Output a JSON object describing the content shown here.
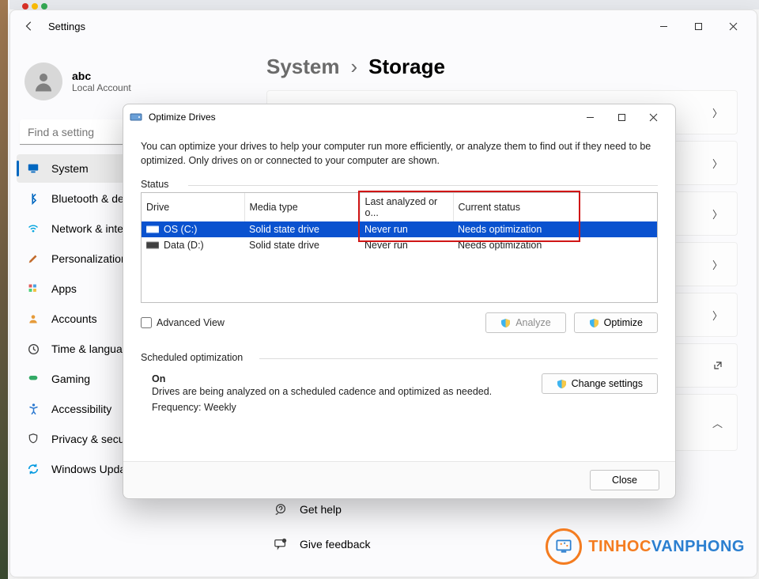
{
  "window": {
    "appTitle": "Settings"
  },
  "user": {
    "name": "abc",
    "sub": "Local Account"
  },
  "search": {
    "placeholder": "Find a setting"
  },
  "nav": [
    {
      "label": "System",
      "active": true,
      "iconColor": "#0067c0",
      "iconName": "display-icon"
    },
    {
      "label": "Bluetooth & devices",
      "iconColor": "#0067c0",
      "iconName": "bluetooth-icon"
    },
    {
      "label": "Network & internet",
      "iconColor": "#00a4df",
      "iconName": "wifi-icon"
    },
    {
      "label": "Personalization",
      "iconColor": "#c26b2c",
      "iconName": "brush-icon"
    },
    {
      "label": "Apps",
      "iconColor": "#404040",
      "iconName": "apps-icon"
    },
    {
      "label": "Accounts",
      "iconColor": "#e69b3a",
      "iconName": "person-icon"
    },
    {
      "label": "Time & language",
      "iconColor": "#404040",
      "iconName": "clock-icon"
    },
    {
      "label": "Gaming",
      "iconColor": "#33aa66",
      "iconName": "gaming-icon"
    },
    {
      "label": "Accessibility",
      "iconColor": "#2a78d0",
      "iconName": "accessibility-icon"
    },
    {
      "label": "Privacy & security",
      "iconColor": "#404040",
      "iconName": "shield-icon"
    },
    {
      "label": "Windows Update",
      "iconColor": "#0099e0",
      "iconName": "update-icon"
    }
  ],
  "breadcrumb": {
    "parent": "System",
    "current": "Storage"
  },
  "help": {
    "get": "Get help",
    "feedback": "Give feedback"
  },
  "dialog": {
    "title": "Optimize Drives",
    "desc": "You can optimize your drives to help your computer run more efficiently, or analyze them to find out if they need to be optimized. Only drives on or connected to your computer are shown.",
    "statusLabel": "Status",
    "columns": {
      "drive": "Drive",
      "media": "Media type",
      "last": "Last analyzed or o...",
      "status": "Current status"
    },
    "drives": [
      {
        "name": "OS (C:)",
        "media": "Solid state drive",
        "last": "Never run",
        "status": "Needs optimization",
        "selected": true
      },
      {
        "name": "Data (D:)",
        "media": "Solid state drive",
        "last": "Never run",
        "status": "Needs optimization",
        "selected": false
      }
    ],
    "advanced": "Advanced View",
    "analyze": "Analyze",
    "optimize": "Optimize",
    "schedLabel": "Scheduled optimization",
    "schedOn": "On",
    "schedDesc": "Drives are being analyzed on a scheduled cadence and optimized as needed.",
    "schedFreqLabel": "Frequency:",
    "schedFreqValue": "Weekly",
    "changeSettings": "Change settings",
    "close": "Close"
  },
  "watermark": {
    "t1": "TINHOC",
    "t2": "VANPHONG"
  }
}
